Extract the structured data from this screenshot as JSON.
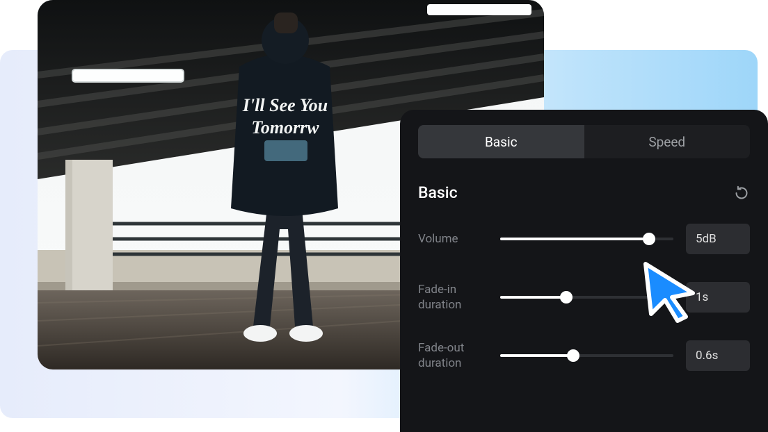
{
  "photo": {
    "hoodie_text_line1": "I'll See You",
    "hoodie_text_line2": "Tomorrw"
  },
  "panel": {
    "tabs": {
      "basic": "Basic",
      "speed": "Speed"
    },
    "section_title": "Basic",
    "controls": {
      "volume": {
        "label": "Volume",
        "value": "5dB",
        "fill_percent": 86
      },
      "fade_in": {
        "label": "Fade-in duration",
        "value": "1s",
        "fill_percent": 38
      },
      "fade_out": {
        "label": "Fade-out duration",
        "value": "0.6s",
        "fill_percent": 42
      }
    }
  },
  "colors": {
    "accent": "#1a8cff"
  }
}
